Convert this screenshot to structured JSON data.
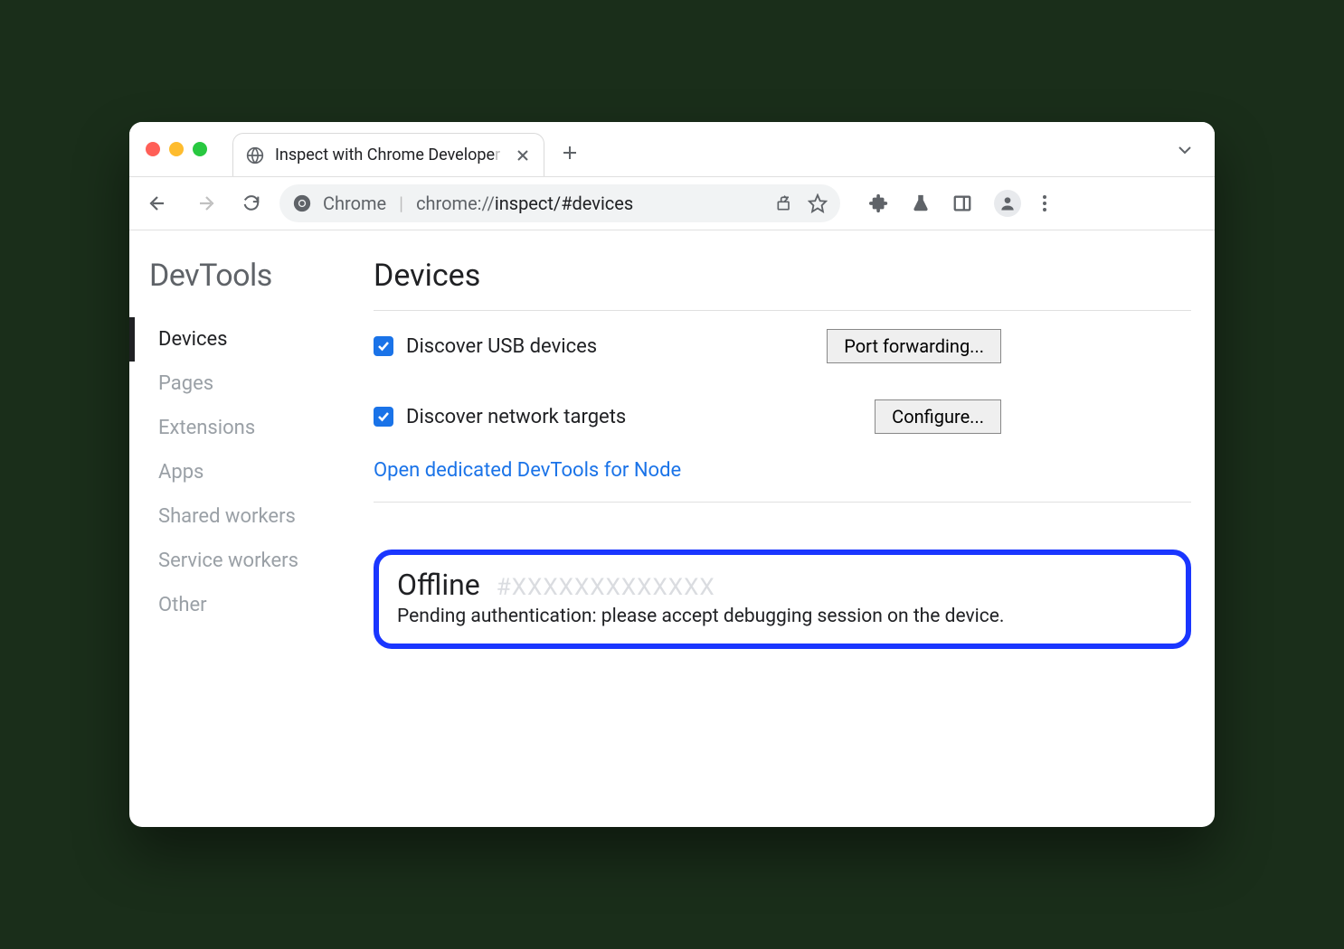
{
  "tab": {
    "title_visible": "Inspect with Chrome Develope",
    "title_faded": "r"
  },
  "omnibox": {
    "label": "Chrome",
    "url_main": "chrome://",
    "url_path": "inspect/",
    "url_hash": "#devices"
  },
  "sidebar": {
    "title": "DevTools",
    "items": [
      {
        "label": "Devices",
        "active": true
      },
      {
        "label": "Pages",
        "active": false
      },
      {
        "label": "Extensions",
        "active": false
      },
      {
        "label": "Apps",
        "active": false
      },
      {
        "label": "Shared workers",
        "active": false
      },
      {
        "label": "Service workers",
        "active": false
      },
      {
        "label": "Other",
        "active": false
      }
    ]
  },
  "main": {
    "heading": "Devices",
    "discover_usb_label": "Discover USB devices",
    "discover_usb_checked": true,
    "port_forwarding_btn": "Port forwarding...",
    "discover_network_label": "Discover network targets",
    "discover_network_checked": true,
    "configure_btn": "Configure...",
    "node_link": "Open dedicated DevTools for Node",
    "offline": {
      "title": "Offline",
      "hash": "#XXXXXXXXXXXXX",
      "message": "Pending authentication: please accept debugging session on the device."
    }
  }
}
